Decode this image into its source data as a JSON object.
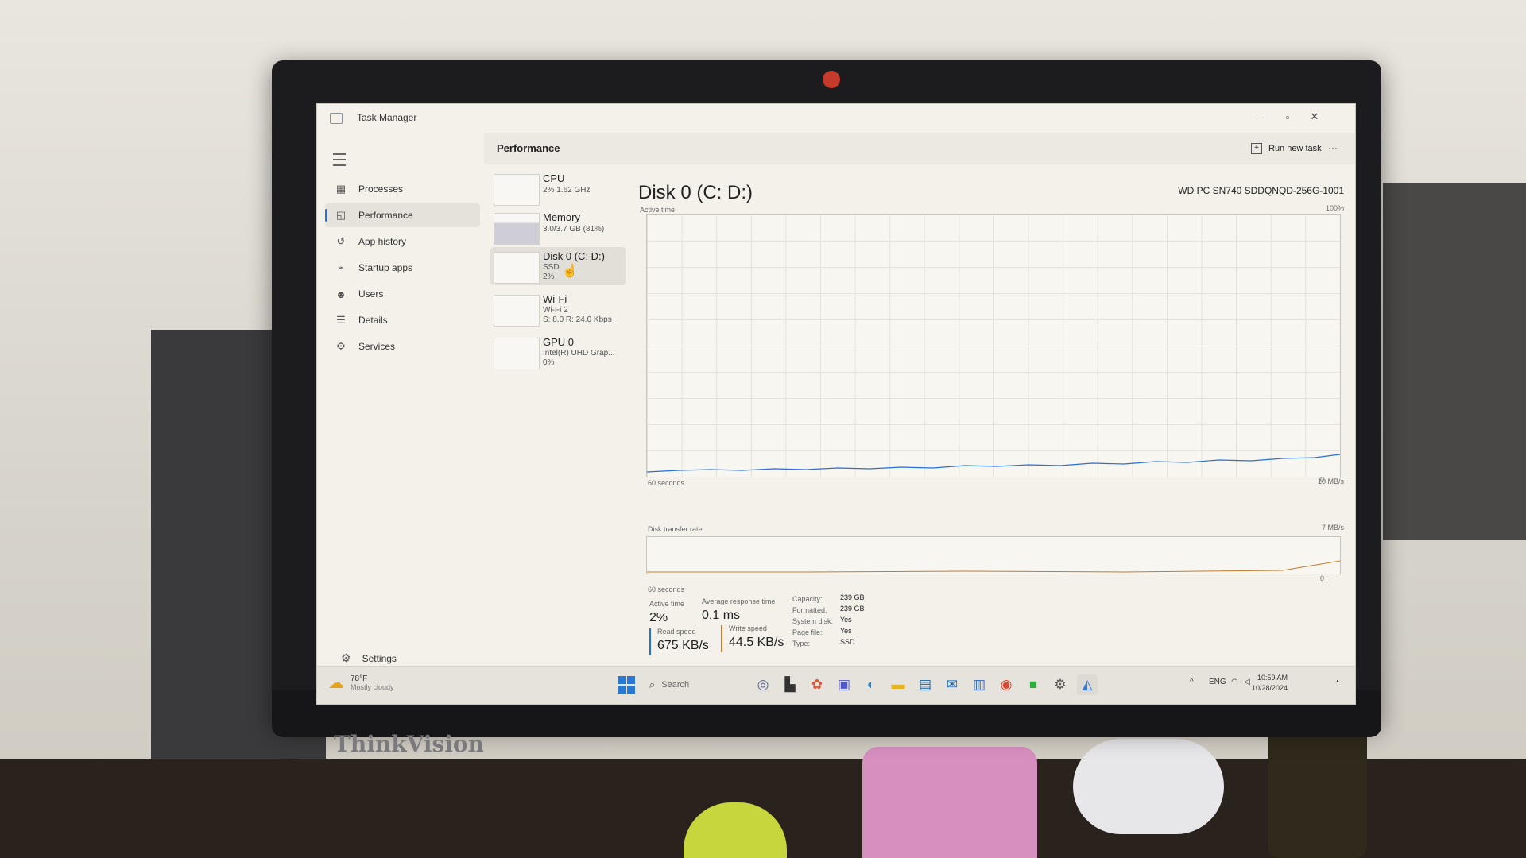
{
  "window": {
    "title": "Task Manager",
    "minimize": "–",
    "maximize": "▫",
    "close": "✕"
  },
  "sidebar": {
    "items": [
      {
        "label": "Processes",
        "icon": "processes-icon",
        "glyph": "▦"
      },
      {
        "label": "Performance",
        "icon": "performance-icon",
        "glyph": "◱"
      },
      {
        "label": "App history",
        "icon": "history-icon",
        "glyph": "↺"
      },
      {
        "label": "Startup apps",
        "icon": "startup-icon",
        "glyph": "⌁"
      },
      {
        "label": "Users",
        "icon": "users-icon",
        "glyph": "☻"
      },
      {
        "label": "Details",
        "icon": "details-icon",
        "glyph": "☰"
      },
      {
        "label": "Services",
        "icon": "services-icon",
        "glyph": "⚙"
      }
    ],
    "settings": "Settings"
  },
  "header": {
    "title": "Performance",
    "run_new_task": "Run new task",
    "more": "···"
  },
  "resources": [
    {
      "name": "CPU",
      "sub1": "2% 1.62 GHz",
      "sub2": "",
      "sub3": ""
    },
    {
      "name": "Memory",
      "sub1": "3.0/3.7 GB (81%)",
      "sub2": "",
      "sub3": ""
    },
    {
      "name": "Disk 0 (C: D:)",
      "sub1": "SSD",
      "sub2": "2%",
      "sub3": ""
    },
    {
      "name": "Wi-Fi",
      "sub1": "Wi-Fi 2",
      "sub2": "S: 8.0 R: 24.0 Kbps",
      "sub3": ""
    },
    {
      "name": "GPU 0",
      "sub1": "Intel(R) UHD Grap...",
      "sub2": "0%",
      "sub3": ""
    }
  ],
  "disk": {
    "title": "Disk 0 (C: D:)",
    "model": "WD PC SN740 SDDQNQD-256G-1001",
    "active_time_label": "Active time",
    "max_pct": "100%",
    "zero": "0",
    "seconds": "60 seconds",
    "transfer_label": "Disk transfer rate",
    "transfer_max": "10 MB/s",
    "transfer_mid": "7 MB/s",
    "transfer_zero": "0",
    "seconds2": "60 seconds",
    "stats": {
      "active_time_label": "Active time",
      "active_time": "2%",
      "avg_response_label": "Average response time",
      "avg_response": "0.1 ms",
      "read_label": "Read speed",
      "read": "675 KB/s",
      "write_label": "Write speed",
      "write": "44.5 KB/s"
    },
    "meta": [
      {
        "k": "Capacity:",
        "v": "239 GB"
      },
      {
        "k": "Formatted:",
        "v": "239 GB"
      },
      {
        "k": "System disk:",
        "v": "Yes"
      },
      {
        "k": "Page file:",
        "v": "Yes"
      },
      {
        "k": "Type:",
        "v": "SSD"
      }
    ]
  },
  "taskbar": {
    "temp": "78°F",
    "condition": "Mostly cloudy",
    "search": "Search",
    "lang": "ENG",
    "time": "10:59 AM",
    "date": "10/28/2024"
  },
  "colors": {
    "accent": "#2a6fd6",
    "write_line": "#c47a2b"
  },
  "monitor_brand": "ThinkVision"
}
